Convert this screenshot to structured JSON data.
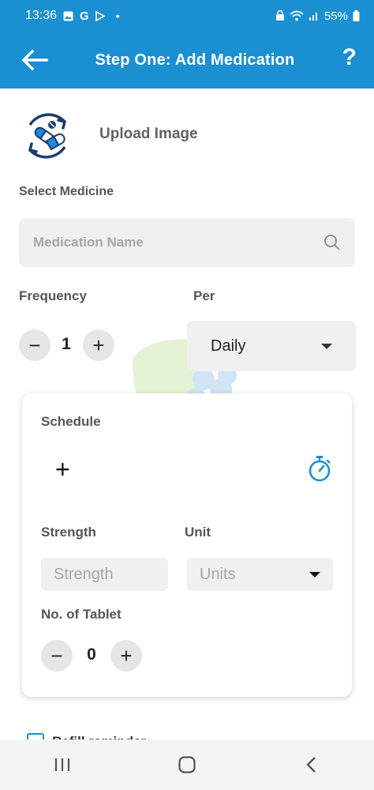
{
  "status_bar": {
    "time": "13:36",
    "left_icons": [
      "image-icon",
      "google-icon",
      "play-store-icon",
      "dot-icon"
    ],
    "battery": "55%"
  },
  "app_bar": {
    "title": "Step One: Add Medication",
    "help": "?"
  },
  "upload": {
    "label": "Upload Image"
  },
  "medicine": {
    "label": "Select Medicine",
    "placeholder": "Medication Name"
  },
  "frequency": {
    "label": "Frequency",
    "value": "1",
    "minus": "−",
    "plus": "+"
  },
  "per": {
    "label": "Per",
    "selected": "Daily"
  },
  "schedule": {
    "label": "Schedule",
    "add": "+",
    "strength_label": "Strength",
    "strength_placeholder": "Strength",
    "unit_label": "Unit",
    "unit_selected": "Units",
    "tablet_label": "No. of Tablet",
    "tablet_value": "0",
    "minus": "−",
    "plus": "+"
  },
  "refill": {
    "label": "Refill reminder"
  },
  "colors": {
    "primary": "#1a8fd1",
    "field_bg": "#f0f0f0"
  }
}
